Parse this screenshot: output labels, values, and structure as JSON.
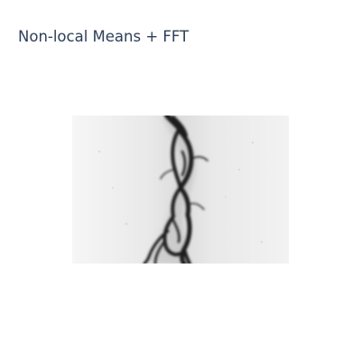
{
  "header": {
    "title": "Non-local Means + FFT"
  },
  "image": {
    "alt_description": "",
    "colors": {
      "background": "#f3f3f3",
      "foreground": "#1a1a1a"
    }
  }
}
